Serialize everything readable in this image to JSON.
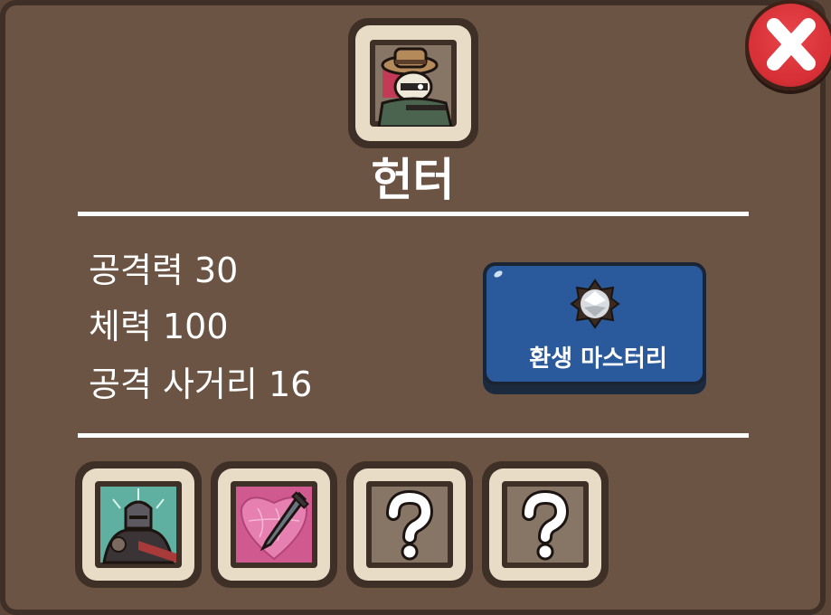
{
  "hero": {
    "name": "헌터",
    "portrait_icon": "hunter-portrait"
  },
  "stats": [
    {
      "label": "공격력 30"
    },
    {
      "label": "체력 100"
    },
    {
      "label": "공격 사거리 16"
    }
  ],
  "mastery_button": {
    "label": "환생 마스터리",
    "icon": "silver-gem-icon"
  },
  "skill_slots": [
    {
      "icon": "warrior-skill-icon",
      "state": "unlocked"
    },
    {
      "icon": "pink-sword-skill-icon",
      "state": "unlocked"
    },
    {
      "icon": "question-mark-icon",
      "state": "locked"
    },
    {
      "icon": "question-mark-icon",
      "state": "locked"
    }
  ],
  "colors": {
    "panel": "#6b5444",
    "border": "#3e2f27",
    "close": "#d62f36",
    "mastery": "#2a5a9c"
  }
}
